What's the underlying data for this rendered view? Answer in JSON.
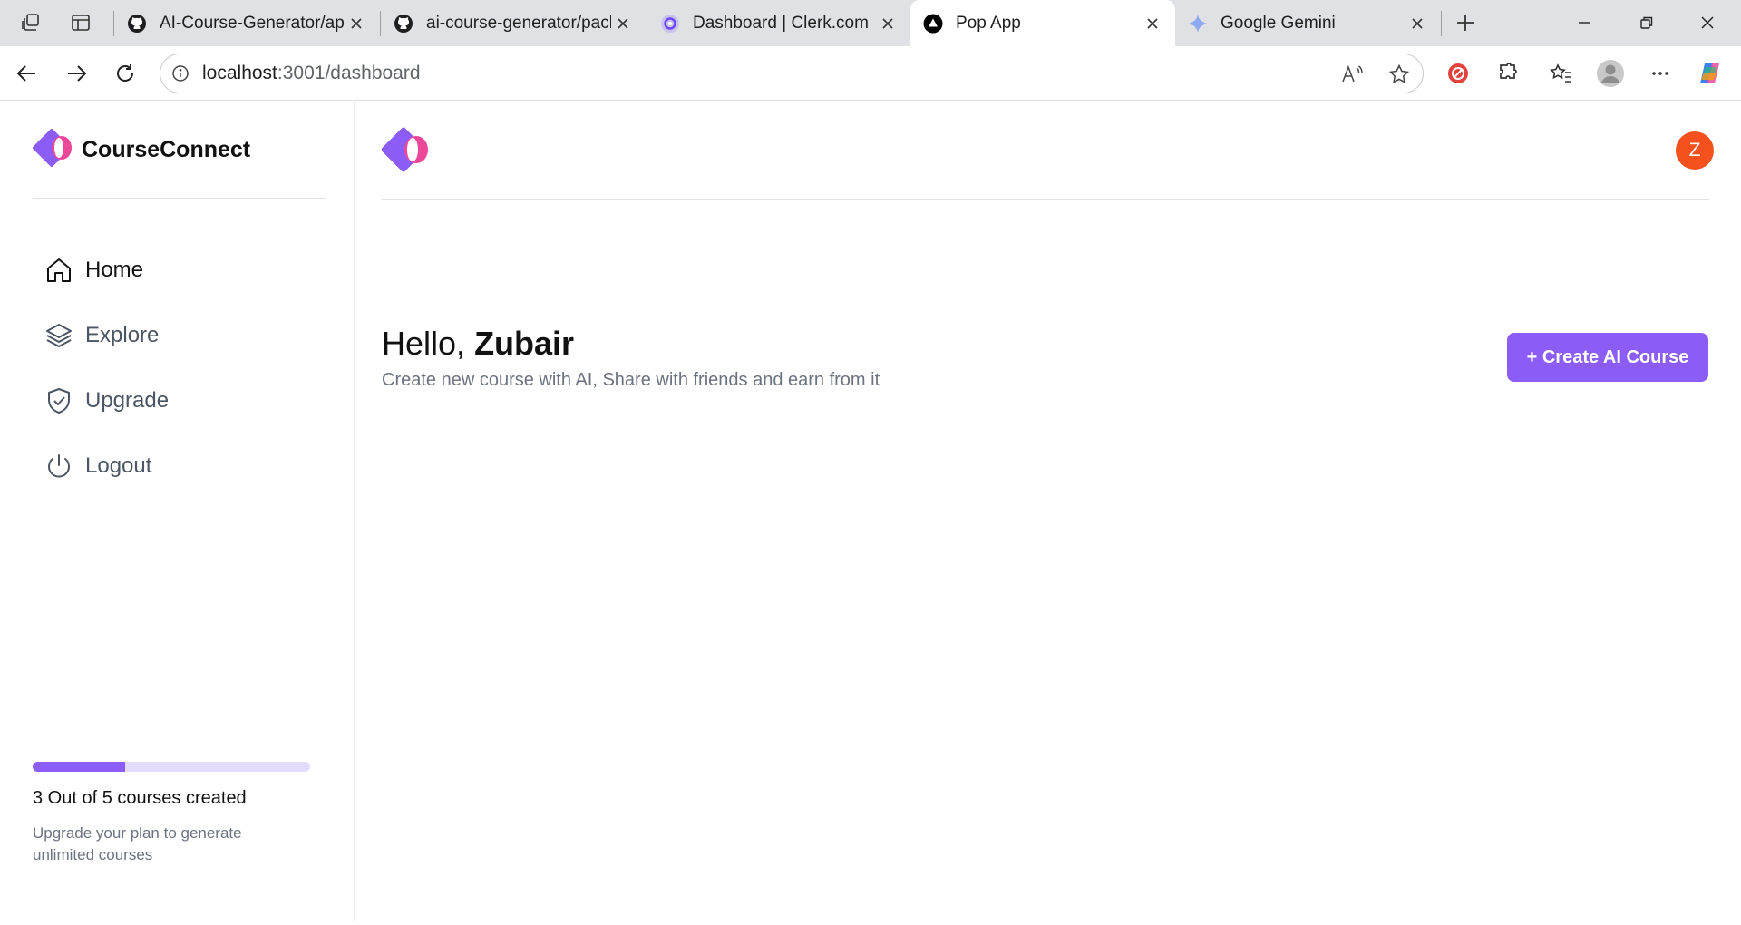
{
  "browser": {
    "tabs": [
      {
        "title": "AI-Course-Generator/app",
        "favicon": "github-icon"
      },
      {
        "title": "ai-course-generator/pack",
        "favicon": "github-icon"
      },
      {
        "title": "Dashboard | Clerk.com",
        "favicon": "clerk-icon"
      },
      {
        "title": "Pop App",
        "favicon": "app-triangle-icon",
        "active": true
      },
      {
        "title": "Google Gemini",
        "favicon": "gemini-icon"
      }
    ],
    "address": {
      "host": "localhost",
      "path": ":3001/dashboard"
    }
  },
  "app": {
    "brand": "CourseConnect",
    "nav": [
      {
        "label": "Home",
        "icon": "home-icon",
        "active": true
      },
      {
        "label": "Explore",
        "icon": "layers-icon"
      },
      {
        "label": "Upgrade",
        "icon": "shield-check-icon"
      },
      {
        "label": "Logout",
        "icon": "power-icon"
      }
    ],
    "usage": {
      "text": "3 Out of 5 courses created",
      "created": 3,
      "limit": 5,
      "note": "Upgrade your plan to generate unlimited courses"
    },
    "user_initial": "Z",
    "greeting": {
      "prefix": "Hello,",
      "name": "Zubair"
    },
    "subtitle": "Create new course with AI, Share with friends and earn from it",
    "create_button": "+ Create AI Course",
    "colors": {
      "accent": "#8b5cf6",
      "accent_light": "#e4dcff",
      "avatar": "#f4511e",
      "logo_pink": "#ec4899"
    }
  }
}
